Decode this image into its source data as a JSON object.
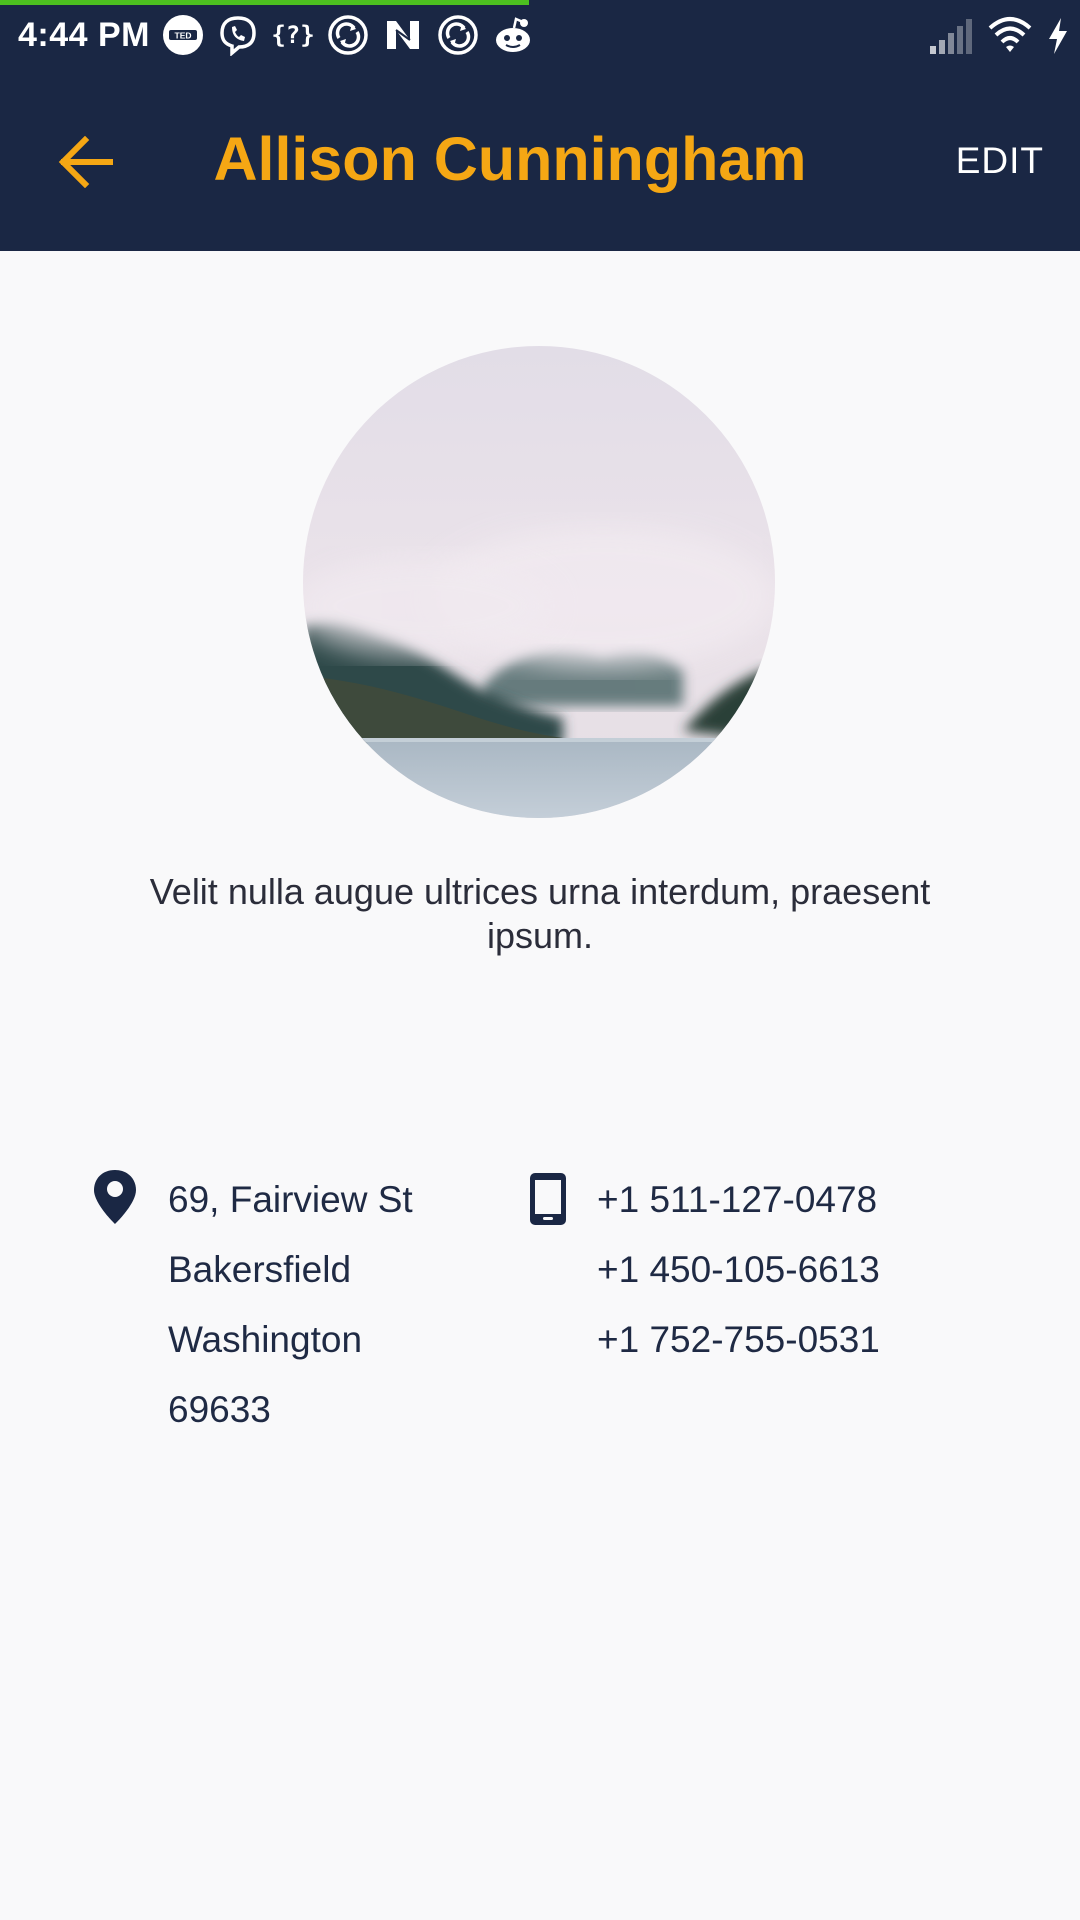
{
  "status_bar": {
    "time": "4:44 PM",
    "page_load_progress": 0.49,
    "notification_icons": [
      "ted-icon",
      "viber-icon",
      "code-braces-icon",
      "sync-icon",
      "n-app-icon",
      "sync-icon",
      "reddit-icon"
    ],
    "system_icons": [
      "cell-signal-icon",
      "wifi-icon",
      "charging-bolt-icon"
    ]
  },
  "toolbar": {
    "title": "Allison Cunningham",
    "edit_label": "EDIT",
    "back_icon": "arrow-left-icon"
  },
  "profile": {
    "bio": "Velit nulla augue ultrices urna interdum, praesent ipsum.",
    "address": {
      "icon": "map-pin-icon",
      "lines": [
        "69, Fairview St",
        "Bakersfield",
        "Washington",
        "69633"
      ]
    },
    "phones": {
      "icon": "mobile-phone-icon",
      "numbers": [
        "+1 511-127-0478",
        "+1 450-105-6613",
        "+1 752-755-0531"
      ]
    }
  },
  "colors": {
    "header_bg": "#1a2744",
    "accent": "#f5a714",
    "page_bg": "#f9f9fa",
    "text_dark": "#1f2a44",
    "progress": "#4cc020"
  }
}
